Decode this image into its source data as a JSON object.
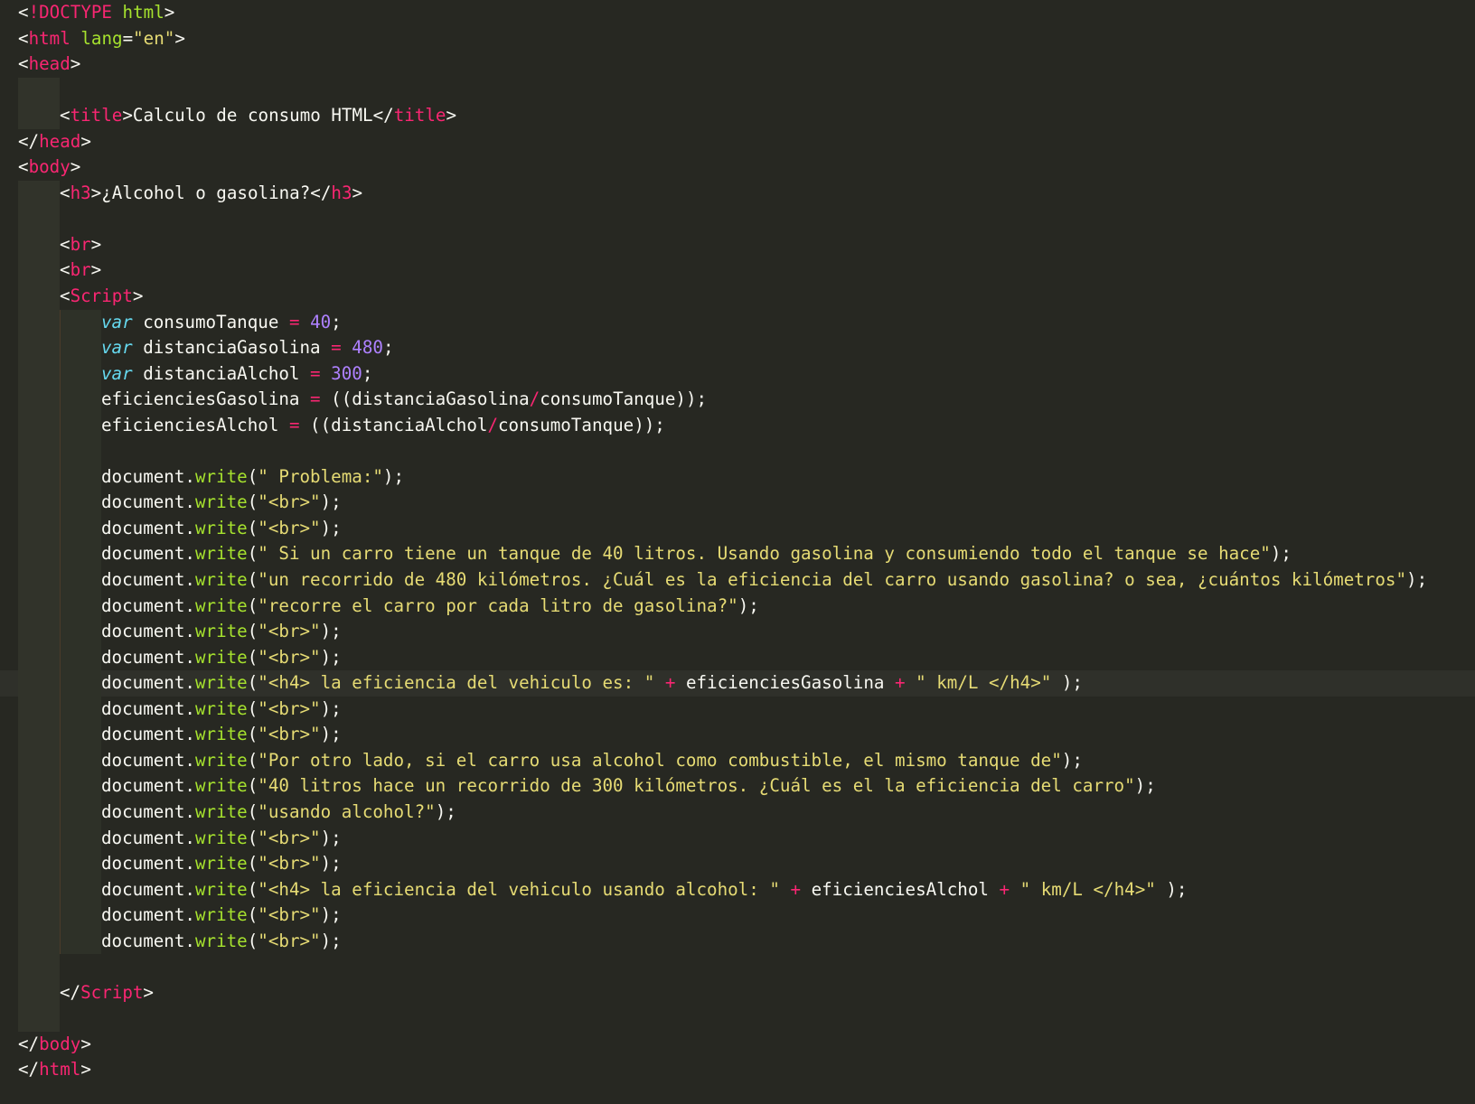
{
  "editor": {
    "theme_colors": {
      "background": "#272822",
      "tag": "#f92672",
      "attribute": "#a6e22e",
      "string": "#e6db74",
      "keyword": "#66d9ef",
      "number": "#ae81ff",
      "text": "#f8f8f2"
    },
    "current_line": 26,
    "lines": [
      {
        "indent": 0,
        "tokens": [
          [
            "punc",
            "<"
          ],
          [
            "tag",
            "!DOCTYPE"
          ],
          [
            "plain",
            " "
          ],
          [
            "attr",
            "html"
          ],
          [
            "punc",
            ">"
          ]
        ]
      },
      {
        "indent": 0,
        "tokens": [
          [
            "punc",
            "<"
          ],
          [
            "tag",
            "html"
          ],
          [
            "plain",
            " "
          ],
          [
            "attr",
            "lang"
          ],
          [
            "punc",
            "="
          ],
          [
            "str",
            "\"en\""
          ],
          [
            "punc",
            ">"
          ]
        ]
      },
      {
        "indent": 0,
        "tokens": [
          [
            "punc",
            "<"
          ],
          [
            "tag",
            "head"
          ],
          [
            "punc",
            ">"
          ]
        ]
      },
      {
        "indent": 1,
        "tokens": []
      },
      {
        "indent": 1,
        "tokens": [
          [
            "punc",
            "<"
          ],
          [
            "tag",
            "title"
          ],
          [
            "punc",
            ">"
          ],
          [
            "plain",
            "Calculo de consumo HTML"
          ],
          [
            "punc",
            "</"
          ],
          [
            "tag",
            "title"
          ],
          [
            "punc",
            ">"
          ]
        ]
      },
      {
        "indent": 0,
        "tokens": [
          [
            "punc",
            "</"
          ],
          [
            "tag",
            "head"
          ],
          [
            "punc",
            ">"
          ]
        ]
      },
      {
        "indent": 0,
        "tokens": [
          [
            "punc",
            "<"
          ],
          [
            "tag",
            "body"
          ],
          [
            "punc",
            ">"
          ]
        ]
      },
      {
        "indent": 1,
        "tokens": [
          [
            "punc",
            "<"
          ],
          [
            "tag",
            "h3"
          ],
          [
            "punc",
            ">"
          ],
          [
            "plain",
            "¿Alcohol o gasolina?"
          ],
          [
            "punc",
            "</"
          ],
          [
            "tag",
            "h3"
          ],
          [
            "punc",
            ">"
          ]
        ]
      },
      {
        "indent": 1,
        "tokens": []
      },
      {
        "indent": 1,
        "tokens": [
          [
            "punc",
            "<"
          ],
          [
            "tag",
            "br"
          ],
          [
            "punc",
            ">"
          ]
        ]
      },
      {
        "indent": 1,
        "tokens": [
          [
            "punc",
            "<"
          ],
          [
            "tag",
            "br"
          ],
          [
            "punc",
            ">"
          ]
        ]
      },
      {
        "indent": 1,
        "tokens": [
          [
            "punc",
            "<"
          ],
          [
            "tag",
            "Script"
          ],
          [
            "punc",
            ">"
          ]
        ]
      },
      {
        "indent": 2,
        "tokens": [
          [
            "kw",
            "var"
          ],
          [
            "plain",
            " consumoTanque "
          ],
          [
            "op",
            "="
          ],
          [
            "plain",
            " "
          ],
          [
            "num",
            "40"
          ],
          [
            "plain",
            ";"
          ]
        ]
      },
      {
        "indent": 2,
        "tokens": [
          [
            "kw",
            "var"
          ],
          [
            "plain",
            " distanciaGasolina "
          ],
          [
            "op",
            "="
          ],
          [
            "plain",
            " "
          ],
          [
            "num",
            "480"
          ],
          [
            "plain",
            ";"
          ]
        ]
      },
      {
        "indent": 2,
        "tokens": [
          [
            "kw",
            "var"
          ],
          [
            "plain",
            " distanciaAlchol "
          ],
          [
            "op",
            "="
          ],
          [
            "plain",
            " "
          ],
          [
            "num",
            "300"
          ],
          [
            "plain",
            ";"
          ]
        ]
      },
      {
        "indent": 2,
        "tokens": [
          [
            "plain",
            "eficienciesGasolina "
          ],
          [
            "op",
            "="
          ],
          [
            "plain",
            " (("
          ],
          [
            "plain",
            "distanciaGasolina"
          ],
          [
            "op",
            "/"
          ],
          [
            "plain",
            "consumoTanque"
          ],
          [
            "plain",
            "));"
          ]
        ]
      },
      {
        "indent": 2,
        "tokens": [
          [
            "plain",
            "eficienciesAlchol "
          ],
          [
            "op",
            "="
          ],
          [
            "plain",
            " (("
          ],
          [
            "plain",
            "distanciaAlchol"
          ],
          [
            "op",
            "/"
          ],
          [
            "plain",
            "consumoTanque"
          ],
          [
            "plain",
            "));"
          ]
        ]
      },
      {
        "indent": 2,
        "tokens": []
      },
      {
        "indent": 2,
        "tokens": [
          [
            "plain",
            "document."
          ],
          [
            "fn",
            "write"
          ],
          [
            "plain",
            "("
          ],
          [
            "str",
            "\" Problema:\""
          ],
          [
            "plain",
            ");"
          ]
        ]
      },
      {
        "indent": 2,
        "tokens": [
          [
            "plain",
            "document."
          ],
          [
            "fn",
            "write"
          ],
          [
            "plain",
            "("
          ],
          [
            "str",
            "\"<br>\""
          ],
          [
            "plain",
            ");"
          ]
        ]
      },
      {
        "indent": 2,
        "tokens": [
          [
            "plain",
            "document."
          ],
          [
            "fn",
            "write"
          ],
          [
            "plain",
            "("
          ],
          [
            "str",
            "\"<br>\""
          ],
          [
            "plain",
            ");"
          ]
        ]
      },
      {
        "indent": 2,
        "tokens": [
          [
            "plain",
            "document."
          ],
          [
            "fn",
            "write"
          ],
          [
            "plain",
            "("
          ],
          [
            "str",
            "\" Si un carro tiene un tanque de 40 litros. Usando gasolina y consumiendo todo el tanque se hace\""
          ],
          [
            "plain",
            ");"
          ]
        ]
      },
      {
        "indent": 2,
        "tokens": [
          [
            "plain",
            "document."
          ],
          [
            "fn",
            "write"
          ],
          [
            "plain",
            "("
          ],
          [
            "str",
            "\"un recorrido de 480 kilómetros. ¿Cuál es la eficiencia del carro usando gasolina? o sea, ¿cuántos kilómetros\""
          ],
          [
            "plain",
            ");"
          ]
        ]
      },
      {
        "indent": 2,
        "tokens": [
          [
            "plain",
            "document."
          ],
          [
            "fn",
            "write"
          ],
          [
            "plain",
            "("
          ],
          [
            "str",
            "\"recorre el carro por cada litro de gasolina?\""
          ],
          [
            "plain",
            ");"
          ]
        ]
      },
      {
        "indent": 2,
        "tokens": [
          [
            "plain",
            "document."
          ],
          [
            "fn",
            "write"
          ],
          [
            "plain",
            "("
          ],
          [
            "str",
            "\"<br>\""
          ],
          [
            "plain",
            ");"
          ]
        ]
      },
      {
        "indent": 2,
        "tokens": [
          [
            "plain",
            "document."
          ],
          [
            "fn",
            "write"
          ],
          [
            "plain",
            "("
          ],
          [
            "str",
            "\"<br>\""
          ],
          [
            "plain",
            ");"
          ]
        ]
      },
      {
        "indent": 2,
        "tokens": [
          [
            "plain",
            "document."
          ],
          [
            "fn",
            "write"
          ],
          [
            "plain",
            "("
          ],
          [
            "str",
            "\"<h4> la eficiencia del vehiculo es: \""
          ],
          [
            "plain",
            " "
          ],
          [
            "op",
            "+"
          ],
          [
            "plain",
            " eficienciesGasolina "
          ],
          [
            "op",
            "+"
          ],
          [
            "plain",
            " "
          ],
          [
            "str",
            "\" km/L </h4>\""
          ],
          [
            "plain",
            " );"
          ]
        ]
      },
      {
        "indent": 2,
        "tokens": [
          [
            "plain",
            "document."
          ],
          [
            "fn",
            "write"
          ],
          [
            "plain",
            "("
          ],
          [
            "str",
            "\"<br>\""
          ],
          [
            "plain",
            ");"
          ]
        ]
      },
      {
        "indent": 2,
        "tokens": [
          [
            "plain",
            "document."
          ],
          [
            "fn",
            "write"
          ],
          [
            "plain",
            "("
          ],
          [
            "str",
            "\"<br>\""
          ],
          [
            "plain",
            ");"
          ]
        ]
      },
      {
        "indent": 2,
        "tokens": [
          [
            "plain",
            "document."
          ],
          [
            "fn",
            "write"
          ],
          [
            "plain",
            "("
          ],
          [
            "str",
            "\"Por otro lado, si el carro usa alcohol como combustible, el mismo tanque de\""
          ],
          [
            "plain",
            ");"
          ]
        ]
      },
      {
        "indent": 2,
        "tokens": [
          [
            "plain",
            "document."
          ],
          [
            "fn",
            "write"
          ],
          [
            "plain",
            "("
          ],
          [
            "str",
            "\"40 litros hace un recorrido de 300 kilómetros. ¿Cuál es el la eficiencia del carro\""
          ],
          [
            "plain",
            ");"
          ]
        ]
      },
      {
        "indent": 2,
        "tokens": [
          [
            "plain",
            "document."
          ],
          [
            "fn",
            "write"
          ],
          [
            "plain",
            "("
          ],
          [
            "str",
            "\"usando alcohol?\""
          ],
          [
            "plain",
            ");"
          ]
        ]
      },
      {
        "indent": 2,
        "tokens": [
          [
            "plain",
            "document."
          ],
          [
            "fn",
            "write"
          ],
          [
            "plain",
            "("
          ],
          [
            "str",
            "\"<br>\""
          ],
          [
            "plain",
            ");"
          ]
        ]
      },
      {
        "indent": 2,
        "tokens": [
          [
            "plain",
            "document."
          ],
          [
            "fn",
            "write"
          ],
          [
            "plain",
            "("
          ],
          [
            "str",
            "\"<br>\""
          ],
          [
            "plain",
            ");"
          ]
        ]
      },
      {
        "indent": 2,
        "tokens": [
          [
            "plain",
            "document."
          ],
          [
            "fn",
            "write"
          ],
          [
            "plain",
            "("
          ],
          [
            "str",
            "\"<h4> la eficiencia del vehiculo usando alcohol: \""
          ],
          [
            "plain",
            " "
          ],
          [
            "op",
            "+"
          ],
          [
            "plain",
            " eficienciesAlchol "
          ],
          [
            "op",
            "+"
          ],
          [
            "plain",
            " "
          ],
          [
            "str",
            "\" km/L </h4>\""
          ],
          [
            "plain",
            " );"
          ]
        ]
      },
      {
        "indent": 2,
        "tokens": [
          [
            "plain",
            "document."
          ],
          [
            "fn",
            "write"
          ],
          [
            "plain",
            "("
          ],
          [
            "str",
            "\"<br>\""
          ],
          [
            "plain",
            ");"
          ]
        ]
      },
      {
        "indent": 2,
        "tokens": [
          [
            "plain",
            "document."
          ],
          [
            "fn",
            "write"
          ],
          [
            "plain",
            "("
          ],
          [
            "str",
            "\"<br>\""
          ],
          [
            "plain",
            ");"
          ]
        ]
      },
      {
        "indent": 1,
        "tokens": []
      },
      {
        "indent": 1,
        "tokens": [
          [
            "punc",
            "</"
          ],
          [
            "tag",
            "Script"
          ],
          [
            "punc",
            ">"
          ]
        ]
      },
      {
        "indent": 1,
        "tokens": []
      },
      {
        "indent": 0,
        "tokens": [
          [
            "punc",
            "</"
          ],
          [
            "tag",
            "body"
          ],
          [
            "punc",
            ">"
          ]
        ]
      },
      {
        "indent": 0,
        "tokens": [
          [
            "punc",
            "</"
          ],
          [
            "tag",
            "html"
          ],
          [
            "punc",
            ">"
          ]
        ]
      }
    ]
  }
}
